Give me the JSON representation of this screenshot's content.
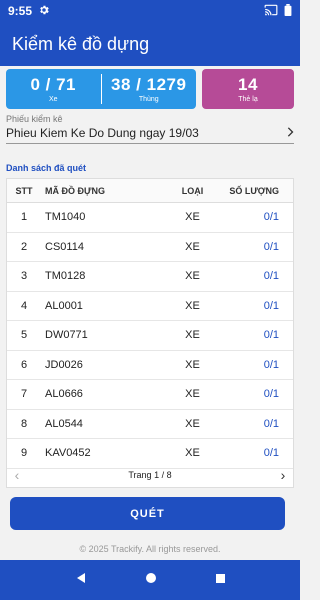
{
  "status_bar": {
    "time": "9:55"
  },
  "app_bar": {
    "title": "Kiểm kê đồ dựng"
  },
  "summary": {
    "vehicles": {
      "value": "0 / 71",
      "label": "Xe"
    },
    "bins": {
      "value": "38 / 1279",
      "label": "Thùng"
    },
    "odd_tags": {
      "value": "14",
      "label": "Thẻ lạ"
    }
  },
  "inventory_sheet": {
    "label": "Phiếu kiểm kê",
    "value": "Phieu Kiem Ke Do Dung ngay 19/03"
  },
  "scanned_list": {
    "title": "Danh sách đã quét",
    "headers": {
      "stt": "STT",
      "code": "MÃ ĐỒ ĐỰNG",
      "type": "LOẠI",
      "qty": "SỐ LƯỢNG"
    },
    "rows": [
      {
        "stt": "1",
        "code": "TM1040",
        "type": "XE",
        "qty": "0/1"
      },
      {
        "stt": "2",
        "code": "CS0114",
        "type": "XE",
        "qty": "0/1"
      },
      {
        "stt": "3",
        "code": "TM0128",
        "type": "XE",
        "qty": "0/1"
      },
      {
        "stt": "4",
        "code": "AL0001",
        "type": "XE",
        "qty": "0/1"
      },
      {
        "stt": "5",
        "code": "DW0771",
        "type": "XE",
        "qty": "0/1"
      },
      {
        "stt": "6",
        "code": "JD0026",
        "type": "XE",
        "qty": "0/1"
      },
      {
        "stt": "7",
        "code": "AL0666",
        "type": "XE",
        "qty": "0/1"
      },
      {
        "stt": "8",
        "code": "AL0544",
        "type": "XE",
        "qty": "0/1"
      },
      {
        "stt": "9",
        "code": "KAV0452",
        "type": "XE",
        "qty": "0/1"
      }
    ]
  },
  "pagination": {
    "label": "Trang 1 / 8"
  },
  "scan_button": {
    "label": "QUÉT"
  },
  "footer": {
    "copyright": "© 2025 Trackify. All rights reserved."
  },
  "colors": {
    "primary": "#1f4fc1",
    "card_blue": "#2b97e6",
    "card_purple": "#b64b97"
  }
}
